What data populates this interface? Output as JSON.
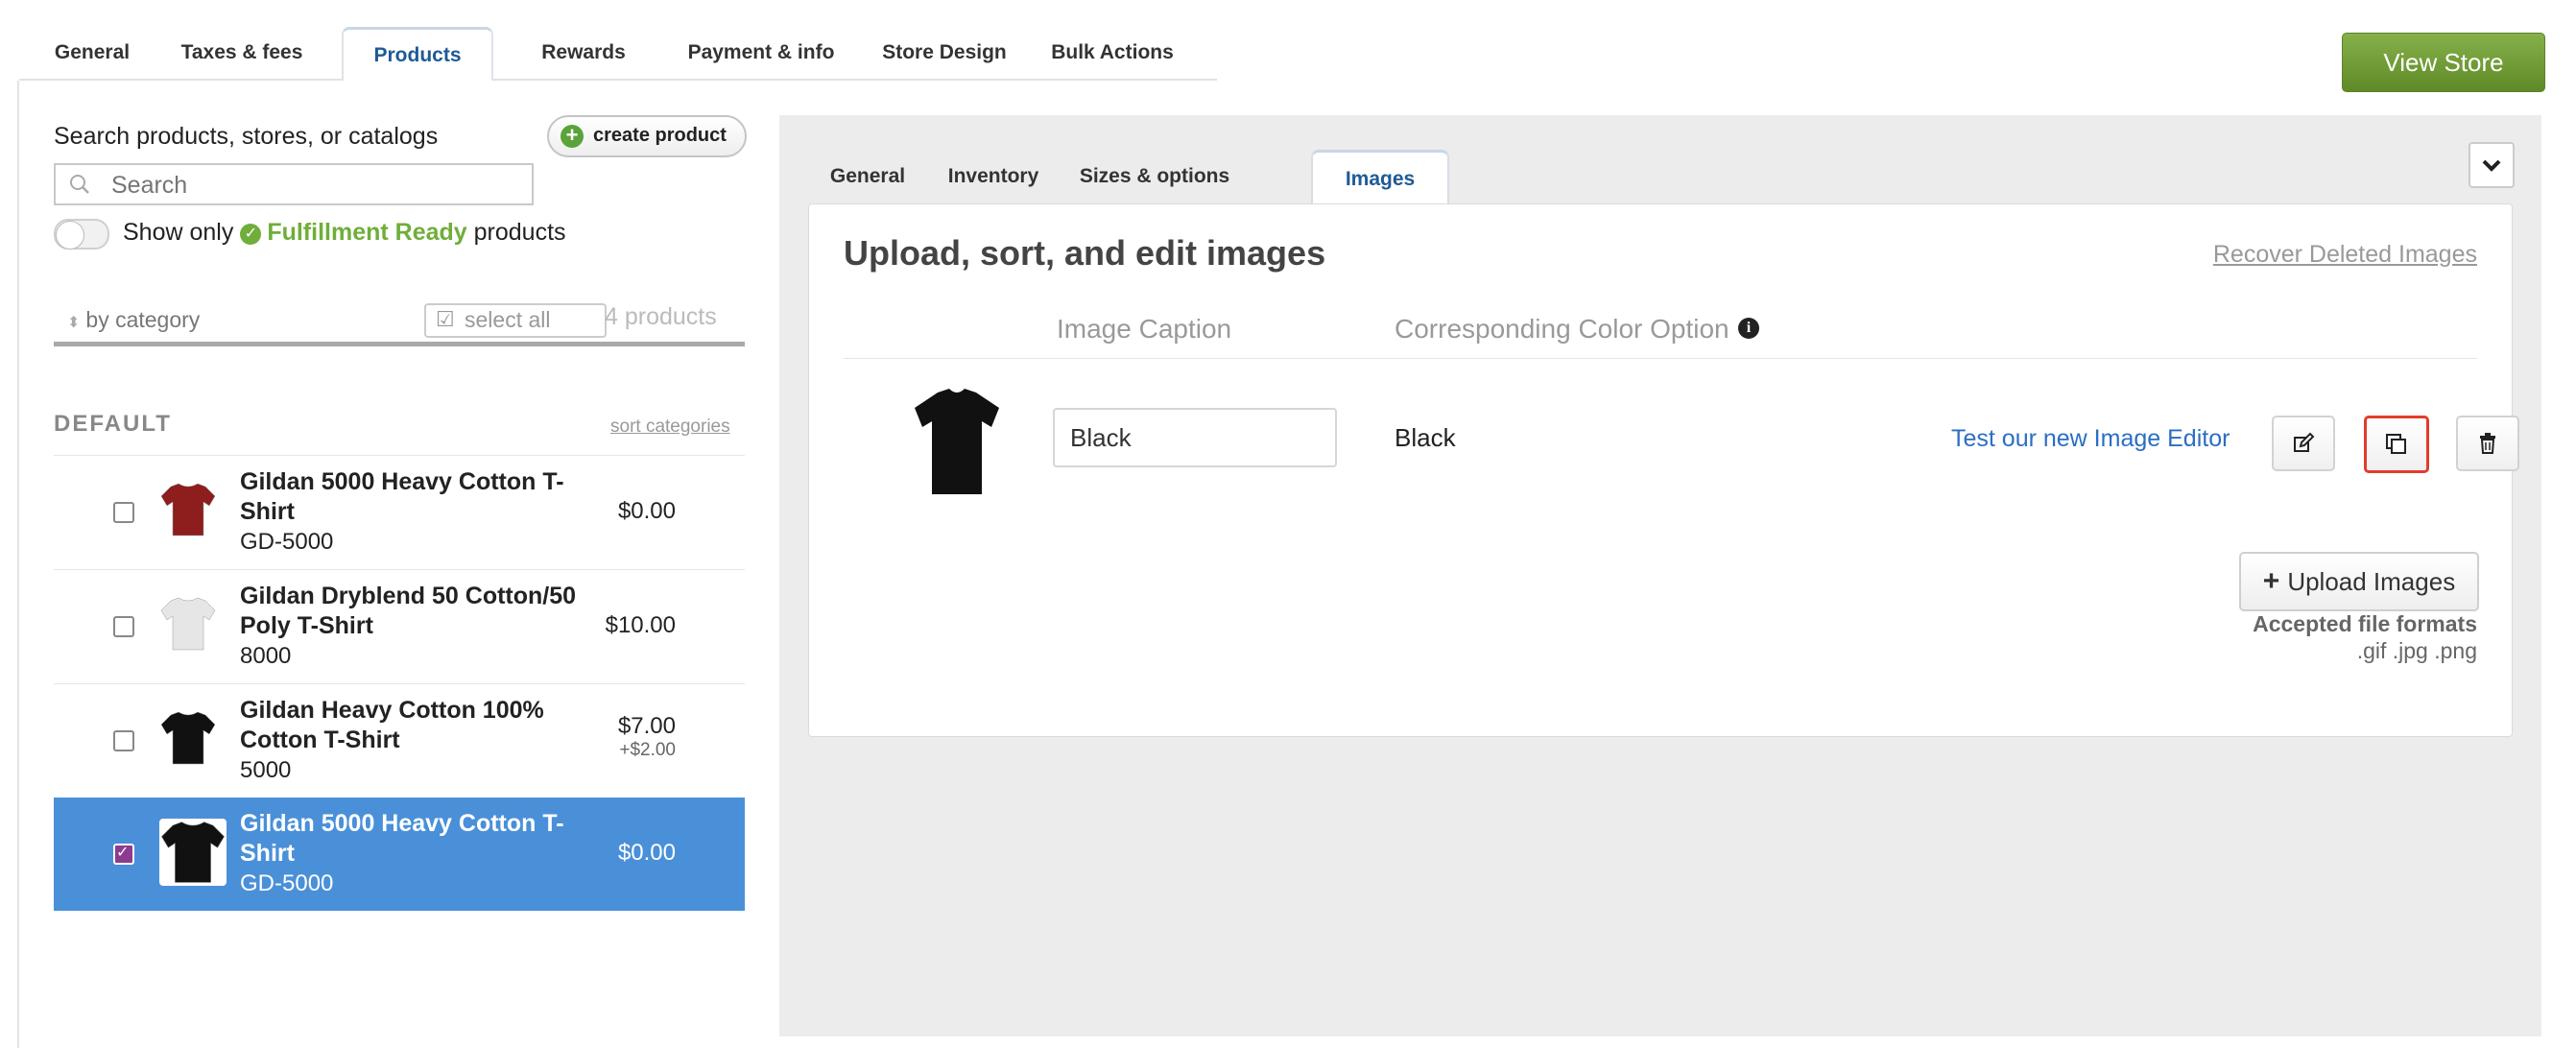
{
  "top_tabs": [
    "General",
    "Taxes & fees",
    "Products",
    "Rewards",
    "Payment & info",
    "Store Design",
    "Bulk Actions"
  ],
  "active_top_tab": "Products",
  "view_store_label": "View Store",
  "left": {
    "search_title": "Search products, stores, or catalogs",
    "create_product_label": "create product",
    "search_placeholder": "Search",
    "show_only_prefix": "Show only",
    "fulfillment_ready": "Fulfillment Ready",
    "show_only_suffix": "products",
    "by_category": "by category",
    "select_all": "select all",
    "product_count": "4 products",
    "category_name": "DEFAULT",
    "sort_categories": "sort categories",
    "products": [
      {
        "name": "Gildan 5000 Heavy Cotton T-Shirt",
        "sku": "GD-5000",
        "price": "$0.00",
        "price_extra": "",
        "shirt_color": "#8e1d1d",
        "checked": false,
        "selected": false
      },
      {
        "name": "Gildan Dryblend 50 Cotton/50 Poly T-Shirt",
        "sku": "8000",
        "price": "$10.00",
        "price_extra": "",
        "shirt_color": "#e6e6e6",
        "checked": false,
        "selected": false
      },
      {
        "name": "Gildan Heavy Cotton 100% Cotton T-Shirt",
        "sku": "5000",
        "price": "$7.00",
        "price_extra": "+$2.00",
        "shirt_color": "#111111",
        "checked": false,
        "selected": false
      },
      {
        "name": "Gildan 5000 Heavy Cotton T-Shirt",
        "sku": "GD-5000",
        "price": "$0.00",
        "price_extra": "",
        "shirt_color": "#111111",
        "checked": true,
        "selected": true
      }
    ]
  },
  "right": {
    "inner_tabs": [
      "General",
      "Inventory",
      "Sizes & options",
      "Images"
    ],
    "active_inner_tab": "Images",
    "card_title": "Upload, sort, and edit images",
    "recover_link": "Recover Deleted Images",
    "col_caption": "Image Caption",
    "col_color": "Corresponding Color Option",
    "image_row": {
      "caption_value": "Black",
      "color_option": "Black",
      "editor_link": "Test our new Image Editor",
      "shirt_color": "#111111"
    },
    "upload_label": "Upload Images",
    "accepted_label": "Accepted file formats",
    "formats": ".gif .jpg .png"
  },
  "colors": {
    "accent_blue": "#4a90d9",
    "green": "#6fae3a",
    "highlight_red": "#e23c2b"
  }
}
